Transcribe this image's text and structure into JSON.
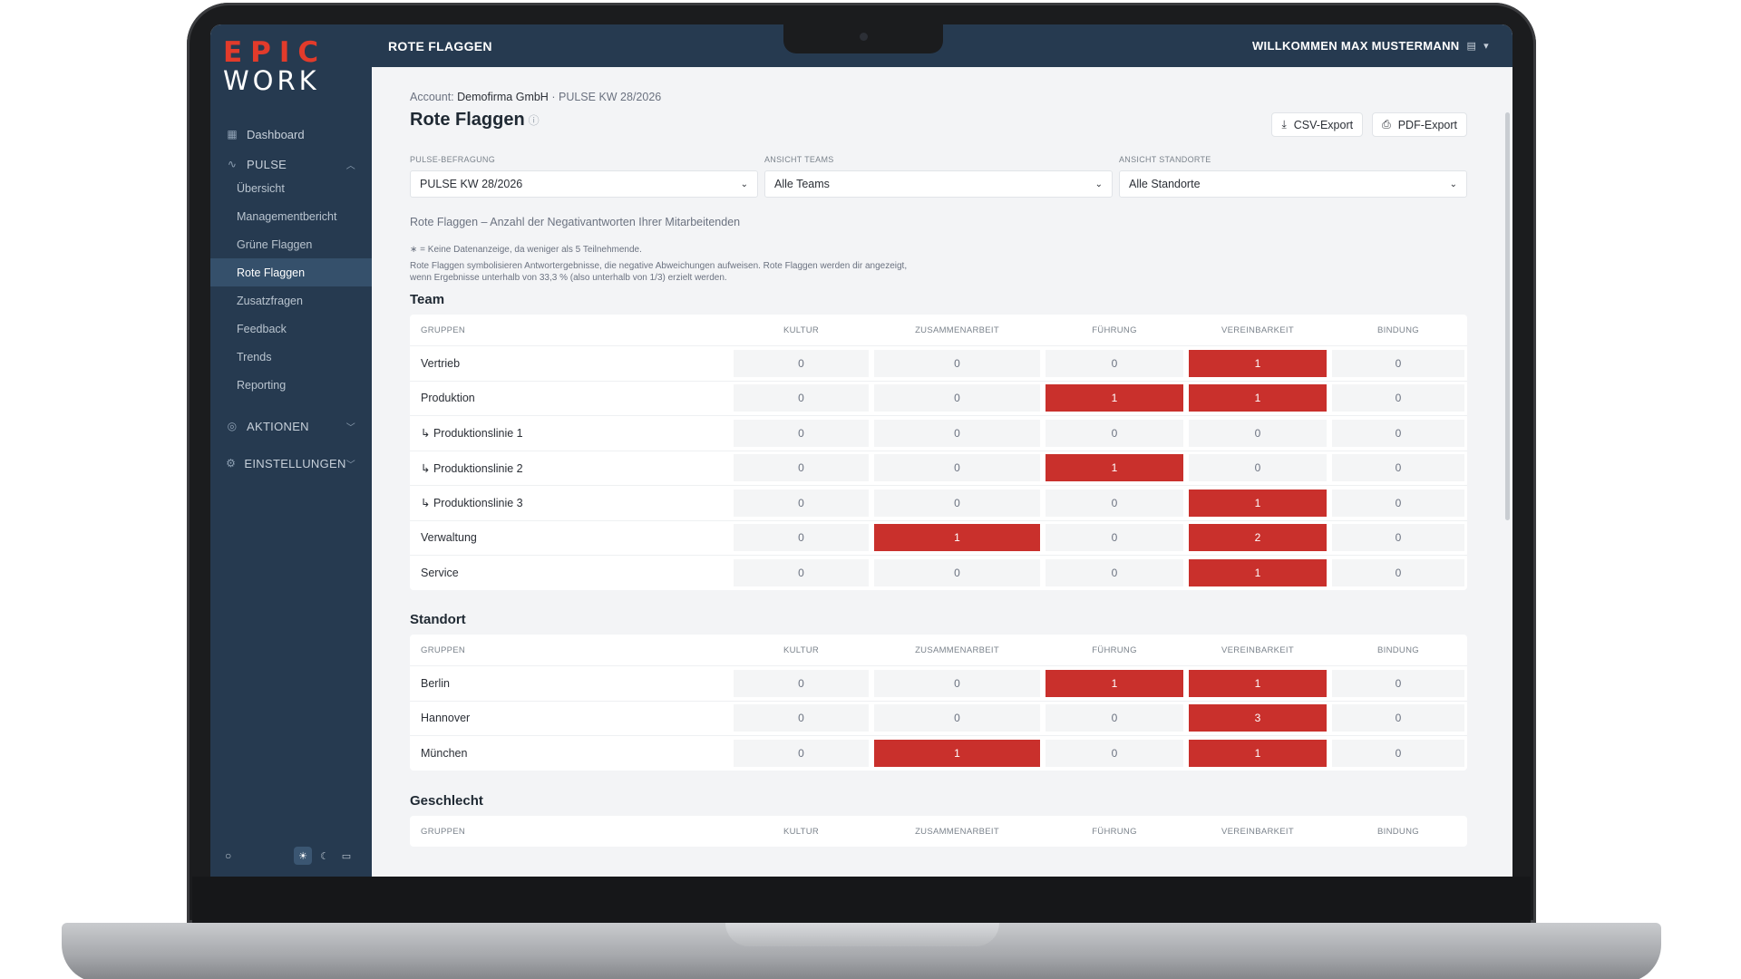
{
  "logo": {
    "line1": "EPIC",
    "line2": "WORK"
  },
  "sidebar": {
    "dashboard": "Dashboard",
    "pulse": "PULSE",
    "pulse_items": [
      "Übersicht",
      "Managementbericht",
      "Grüne Flaggen",
      "Rote Flaggen",
      "Zusatzfragen",
      "Feedback",
      "Trends",
      "Reporting"
    ],
    "active_item": "Rote Flaggen",
    "aktionen": "AKTIONEN",
    "einstellungen": "EINSTELLUNGEN"
  },
  "topbar": {
    "title": "ROTE FLAGGEN",
    "welcome": "WILLKOMMEN MAX MUSTERMANN"
  },
  "breadcrumb": {
    "prefix": "Account:",
    "account": "Demofirma GmbH",
    "separator": "·",
    "survey": "PULSE KW 28/2026"
  },
  "page": {
    "title": "Rote Flaggen",
    "csv_export": "CSV-Export",
    "pdf_export": "PDF-Export",
    "description": "Rote Flaggen – Anzahl der Negativantworten Ihrer Mitarbeitenden",
    "note1": "∗ = Keine Datenanzeige, da weniger als 5 Teilnehmende.",
    "note2": "Rote Flaggen symbolisieren Antwortergebnisse, die negative Abweichungen aufweisen. Rote Flaggen werden dir angezeigt, wenn Ergebnisse unterhalb von 33,3 % (also unterhalb von 1/3) erzielt werden."
  },
  "filters": [
    {
      "label": "PULSE-BEFRAGUNG",
      "value": "PULSE KW 28/2026"
    },
    {
      "label": "ANSICHT TEAMS",
      "value": "Alle Teams"
    },
    {
      "label": "ANSICHT STANDORTE",
      "value": "Alle Standorte"
    }
  ],
  "columns": [
    "GRUPPEN",
    "KULTUR",
    "ZUSAMMENARBEIT",
    "FÜHRUNG",
    "VEREINBARKEIT",
    "BINDUNG"
  ],
  "colors": {
    "sidebar": "#263a50",
    "flag": "#c9302c",
    "brand": "#e23b2b"
  },
  "sections": [
    {
      "title": "Team",
      "rows": [
        {
          "group": "Vertrieb",
          "values": [
            0,
            0,
            0,
            1,
            0
          ]
        },
        {
          "group": "Produktion",
          "values": [
            0,
            0,
            1,
            1,
            0
          ]
        },
        {
          "group": "↳ Produktionslinie 1",
          "values": [
            0,
            0,
            0,
            0,
            0
          ]
        },
        {
          "group": "↳ Produktionslinie 2",
          "values": [
            0,
            0,
            1,
            0,
            0
          ]
        },
        {
          "group": "↳ Produktionslinie 3",
          "values": [
            0,
            0,
            0,
            1,
            0
          ]
        },
        {
          "group": "Verwaltung",
          "values": [
            0,
            1,
            0,
            2,
            0
          ]
        },
        {
          "group": "Service",
          "values": [
            0,
            0,
            0,
            1,
            0
          ]
        }
      ]
    },
    {
      "title": "Standort",
      "rows": [
        {
          "group": "Berlin",
          "values": [
            0,
            0,
            1,
            1,
            0
          ]
        },
        {
          "group": "Hannover",
          "values": [
            0,
            0,
            0,
            3,
            0
          ]
        },
        {
          "group": "München",
          "values": [
            0,
            1,
            0,
            1,
            0
          ]
        }
      ]
    },
    {
      "title": "Geschlecht",
      "rows": []
    }
  ]
}
